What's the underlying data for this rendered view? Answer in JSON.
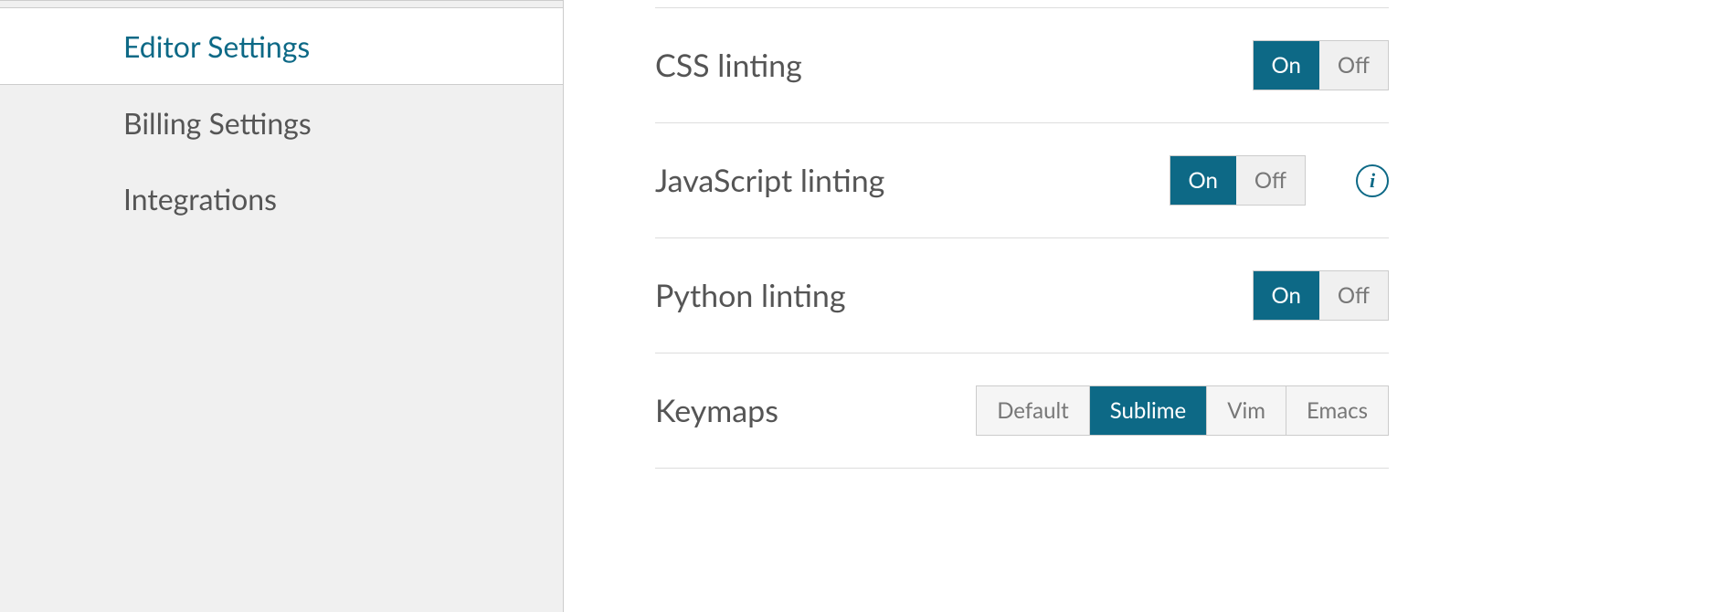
{
  "sidebar": {
    "items": [
      {
        "label": "Editor Settings",
        "active": true
      },
      {
        "label": "Billing Settings",
        "active": false
      },
      {
        "label": "Integrations",
        "active": false
      }
    ]
  },
  "settings": {
    "css_linting": {
      "label": "CSS linting",
      "on": "On",
      "off": "Off",
      "value": "On"
    },
    "js_linting": {
      "label": "JavaScript linting",
      "on": "On",
      "off": "Off",
      "value": "On",
      "has_info": true
    },
    "python_linting": {
      "label": "Python linting",
      "on": "On",
      "off": "Off",
      "value": "On"
    },
    "keymaps": {
      "label": "Keymaps",
      "options": [
        "Default",
        "Sublime",
        "Vim",
        "Emacs"
      ],
      "value": "Sublime"
    }
  },
  "info_glyph": "i"
}
